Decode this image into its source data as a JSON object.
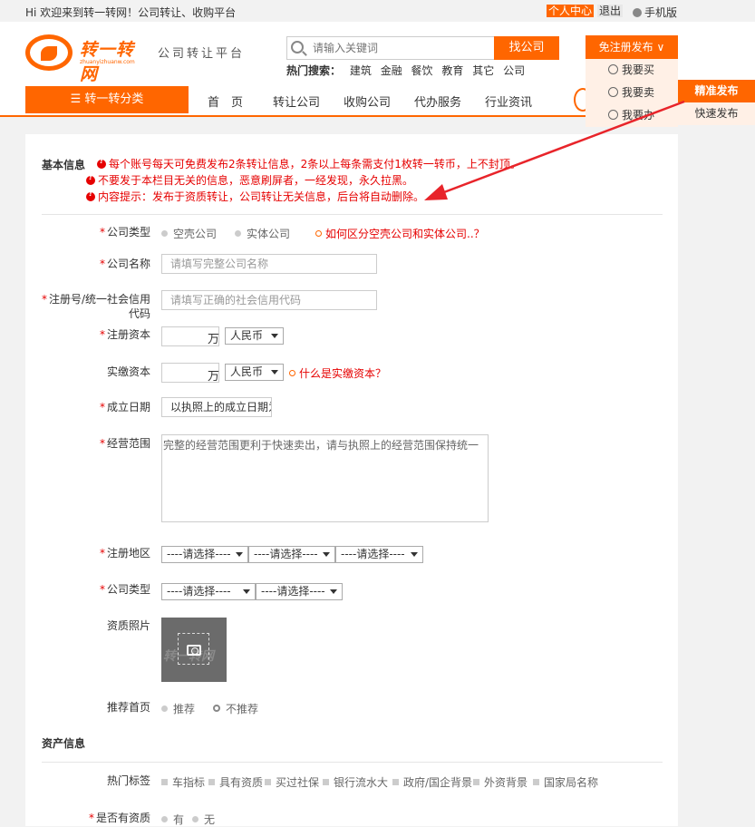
{
  "topbar": {
    "welcome": "Hi 欢迎来到转一转网！公司转让、收购平台",
    "me": "个人中心",
    "logout": "退出",
    "mobile": "手机版"
  },
  "header": {
    "logo_text": "转一转网",
    "logo_sub": "zhuanyizhuanw.com",
    "slogan": "公司转让平台",
    "search_placeholder": "请输入关键词",
    "search_button": "找公司",
    "hot_label": "热门搜索：",
    "hot_items": [
      "建筑",
      "金融",
      "餐饮",
      "教育",
      "其它",
      "公司"
    ],
    "publish_button": "免注册发布",
    "publish_menu": [
      "我要买",
      "我要卖",
      "我要办"
    ],
    "side_menu": [
      "精准发布",
      "快速发布"
    ]
  },
  "nav": {
    "category": "转一转分类",
    "items": [
      "首　页",
      "转让公司",
      "收购公司",
      "代办服务",
      "行业资讯"
    ]
  },
  "form": {
    "basic_title": "基本信息",
    "warnings": [
      "每个账号每天可免费发布2条转让信息，2条以上每条需支付1枚转一转币，上不封顶。",
      "不要发于本栏目无关的信息，恶意刷屏者，一经发现，永久拉黑。",
      "内容提示：发布于资质转让，公司转让无关信息，后台将自动删除。"
    ],
    "company_type_label": "公司类型",
    "company_type_options": [
      "空壳公司",
      "实体公司"
    ],
    "company_type_link": "如何区分空壳公司和实体公司..？",
    "name_label": "公司名称",
    "name_placeholder": "请填写完整公司名称",
    "reg_label_1": "注册号/统一社会信用",
    "reg_label_2": "代码",
    "reg_placeholder": "请填写正确的社会信用代码",
    "capital_label": "注册资本",
    "unit": "万",
    "currency": "人民币",
    "paid_label": "实缴资本",
    "paid_link": "什么是实缴资本？",
    "date_label": "成立日期",
    "date_placeholder": "以执照上的成立日期为准",
    "scope_label": "经营范围",
    "scope_placeholder": "完整的经营范围更利于快速卖出，请与执照上的经营范围保持统一",
    "region_label": "注册地区",
    "select_placeholder": "----请选择----",
    "type2_label": "公司类型",
    "photo_label": "资质照片",
    "photo_watermark": "转一转网",
    "recommend_label": "推荐首页",
    "recommend_options": [
      "推荐",
      "不推荐"
    ],
    "asset_title": "资产信息",
    "tags_label": "热门标签",
    "tags": [
      "车指标",
      "具有资质",
      "买过社保",
      "银行流水大",
      "政府/国企背景",
      "外资背景",
      "国家局名称"
    ],
    "qual_label": "是否有资质",
    "qual_options": [
      "有",
      "无"
    ]
  },
  "colors": {
    "accent": "#ff6600",
    "warning": "#e60000"
  }
}
